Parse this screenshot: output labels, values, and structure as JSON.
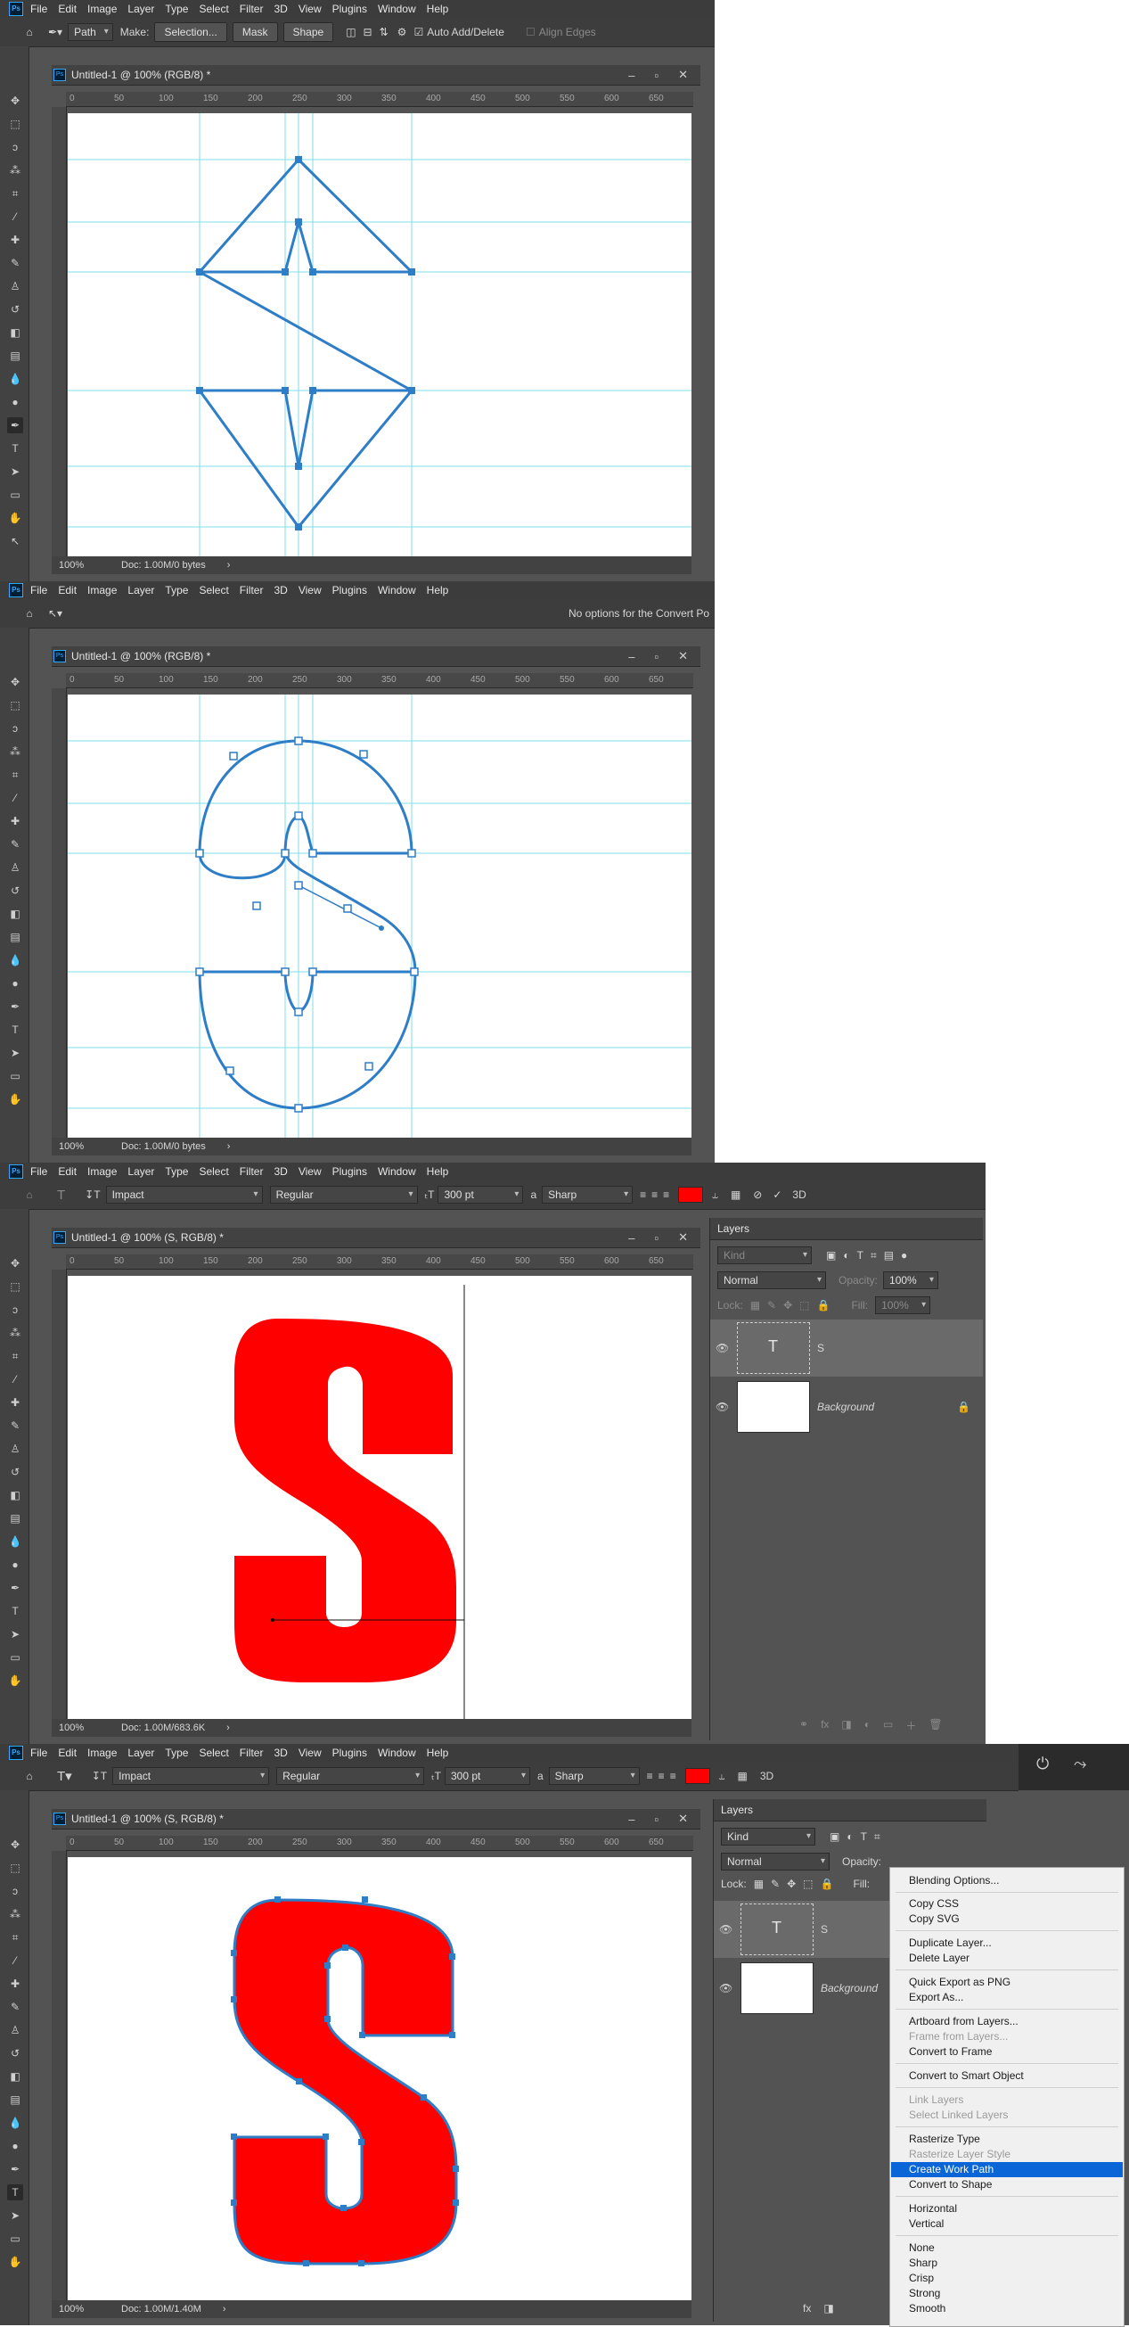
{
  "app": {
    "logo": "Ps"
  },
  "menu": [
    "File",
    "Edit",
    "Image",
    "Layer",
    "Type",
    "Select",
    "Filter",
    "3D",
    "View",
    "Plugins",
    "Window",
    "Help"
  ],
  "panel1": {
    "options": {
      "tool_mode": "Path",
      "make_label": "Make:",
      "selection_btn": "Selection...",
      "mask_btn": "Mask",
      "shape_btn": "Shape",
      "auto_add_delete": "Auto Add/Delete",
      "align_edges": "Align Edges"
    },
    "doc_title": "Untitled-1 @ 100% (RGB/8) *",
    "zoom": "100%",
    "doc_info": "Doc: 1.00M/0 bytes"
  },
  "panel2": {
    "options": {
      "message": "No options for the Convert Po"
    },
    "doc_title": "Untitled-1 @ 100% (RGB/8) *",
    "zoom": "100%",
    "doc_info": "Doc: 1.00M/0 bytes"
  },
  "panel3": {
    "options": {
      "font_family": "Impact",
      "font_style": "Regular",
      "font_size": "300 pt",
      "antialias": "Sharp",
      "aa_prefix": "a",
      "three_d": "3D",
      "text_color": "#ff0000"
    },
    "doc_title": "Untitled-1 @ 100% (S, RGB/8) *",
    "zoom": "100%",
    "doc_info": "Doc: 1.00M/683.6K",
    "glyph": "S"
  },
  "panel4": {
    "options": {
      "font_family": "Impact",
      "font_style": "Regular",
      "font_size": "300 pt",
      "antialias": "Sharp",
      "aa_prefix": "a",
      "three_d": "3D",
      "text_color": "#ff0000"
    },
    "doc_title": "Untitled-1 @ 100% (S, RGB/8) *",
    "zoom": "100%",
    "doc_info": "Doc: 1.00M/1.40M",
    "glyph": "S"
  },
  "ruler_ticks": [
    "0",
    "50",
    "100",
    "150",
    "200",
    "250",
    "300",
    "350",
    "400",
    "450",
    "500",
    "550",
    "600",
    "650"
  ],
  "layers_panel": {
    "title": "Layers",
    "filter_placeholder": "Kind",
    "blend_mode": "Normal",
    "opacity_label": "Opacity:",
    "opacity_value": "100%",
    "lock_label": "Lock:",
    "fill_label": "Fill:",
    "fill_value": "100%",
    "text_layer_name": "S",
    "text_layer_thumb": "T",
    "background_layer_name": "Background",
    "fx_label": "fx"
  },
  "context_menu": {
    "items": [
      {
        "label": "Blending Options...",
        "disabled": false
      },
      {
        "label": "Copy CSS",
        "disabled": false
      },
      {
        "label": "Copy SVG",
        "disabled": false
      },
      {
        "label": "Duplicate Layer...",
        "disabled": false
      },
      {
        "label": "Delete Layer",
        "disabled": false
      },
      {
        "label": "Quick Export as PNG",
        "disabled": false
      },
      {
        "label": "Export As...",
        "disabled": false
      },
      {
        "label": "Artboard from Layers...",
        "disabled": false
      },
      {
        "label": "Frame from Layers...",
        "disabled": true
      },
      {
        "label": "Convert to Frame",
        "disabled": false
      },
      {
        "label": "Convert to Smart Object",
        "disabled": false
      },
      {
        "label": "Link Layers",
        "disabled": true
      },
      {
        "label": "Select Linked Layers",
        "disabled": true
      },
      {
        "label": "Rasterize Type",
        "disabled": false
      },
      {
        "label": "Rasterize Layer Style",
        "disabled": true
      },
      {
        "label": "Create Work Path",
        "disabled": false,
        "selected": true
      },
      {
        "label": "Convert to Shape",
        "disabled": false
      },
      {
        "label": "Horizontal",
        "disabled": false
      },
      {
        "label": "Vertical",
        "disabled": false
      },
      {
        "label": "None",
        "disabled": false
      },
      {
        "label": "Sharp",
        "disabled": false
      },
      {
        "label": "Crisp",
        "disabled": false
      },
      {
        "label": "Strong",
        "disabled": false
      },
      {
        "label": "Smooth",
        "disabled": false
      }
    ]
  },
  "colors": {
    "guide": "#7fdcea",
    "path": "#2e7dc7",
    "accent": "#0a66d6",
    "glyph_fill": "#ff0000"
  }
}
